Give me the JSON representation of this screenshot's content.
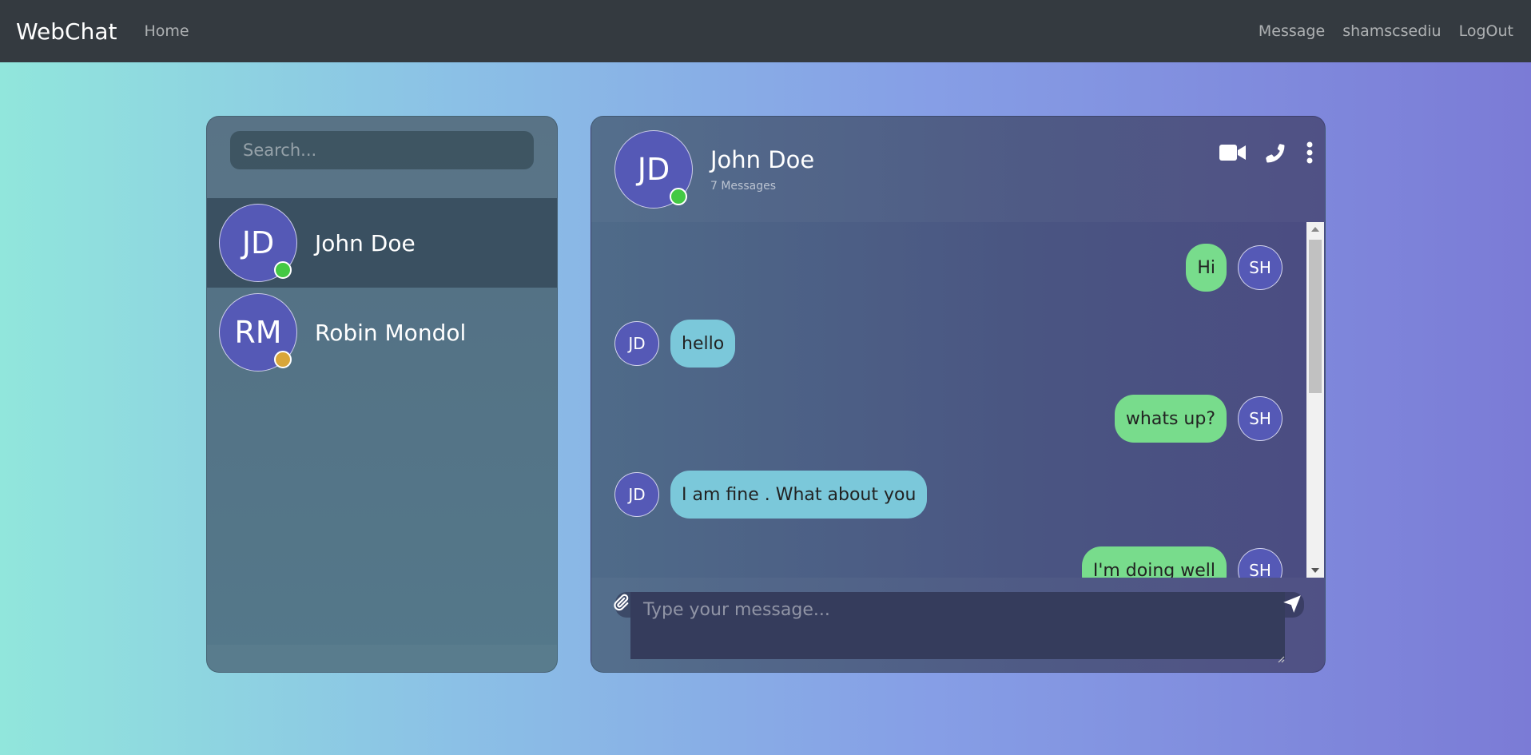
{
  "navbar": {
    "brand": "WebChat",
    "home": "Home",
    "message": "Message",
    "username": "shamscsediu",
    "logout": "LogOut"
  },
  "sidebar": {
    "search_placeholder": "Search...",
    "contacts": [
      {
        "initials": "JD",
        "name": "John Doe",
        "status_color": "#44c944",
        "active": true
      },
      {
        "initials": "RM",
        "name": "Robin Mondol",
        "status_color": "#d9a63a",
        "active": false
      }
    ]
  },
  "chat": {
    "initials": "JD",
    "name": "John Doe",
    "message_count": "7 Messages",
    "status_color": "#44c944",
    "icons": [
      "video-camera-icon",
      "phone-icon",
      "more-vertical-icon"
    ],
    "messages": [
      {
        "direction": "out",
        "avatar": "SH",
        "text": "Hi"
      },
      {
        "direction": "in",
        "avatar": "JD",
        "text": "hello"
      },
      {
        "direction": "out",
        "avatar": "SH",
        "text": "whats up?"
      },
      {
        "direction": "in",
        "avatar": "JD",
        "text": "I am fine . What about you"
      },
      {
        "direction": "out",
        "avatar": "SH",
        "text": "I'm doing well"
      }
    ]
  },
  "composer": {
    "placeholder": "Type your message...",
    "attach_icon": "paperclip-icon",
    "send_icon": "send-icon"
  },
  "colors": {
    "outgoing_bubble": "#78dc8c",
    "incoming_bubble": "#7bc8da",
    "avatar": "#5559b6",
    "navbar": "#343a40"
  }
}
